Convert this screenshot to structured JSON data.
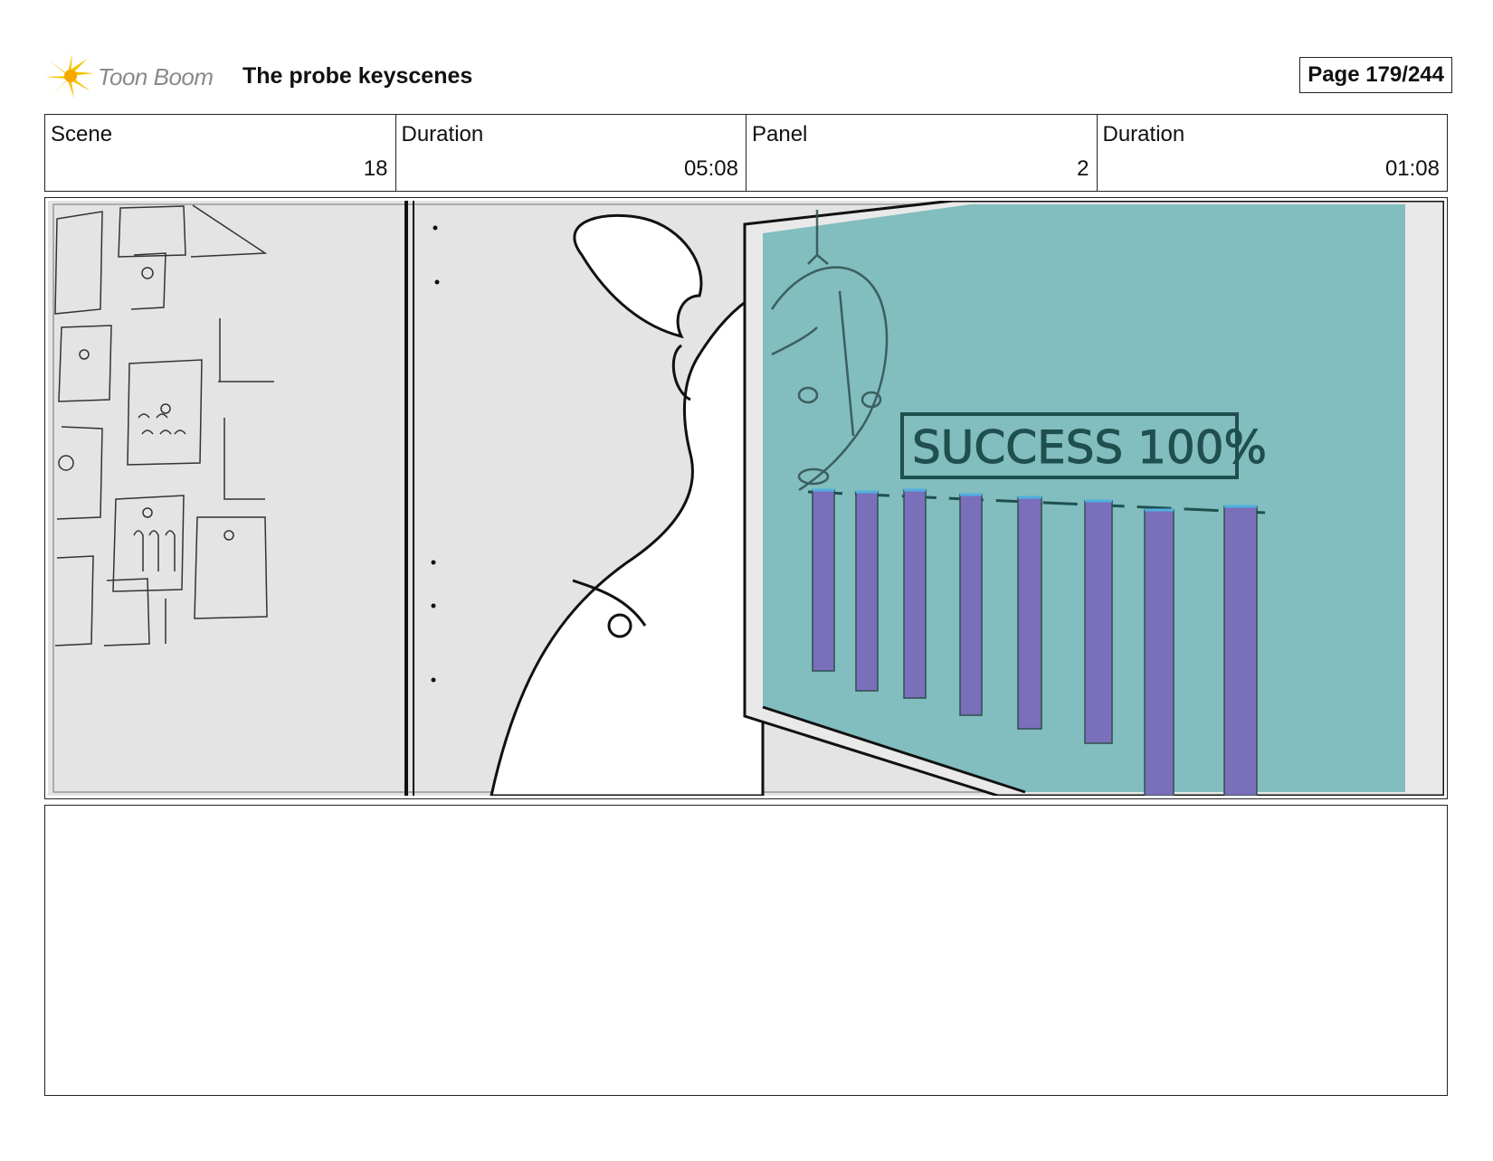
{
  "header": {
    "logo_text": "Toon Boom",
    "doc_title": "The probe keyscenes",
    "page_label": "Page 179/244"
  },
  "info": [
    {
      "label": "Scene",
      "value": "18"
    },
    {
      "label": "Duration",
      "value": "05:08"
    },
    {
      "label": "Panel",
      "value": "2"
    },
    {
      "label": "Duration",
      "value": "01:08"
    }
  ],
  "panel": {
    "screen_text": "SUCCESS 100%",
    "colors": {
      "screen": "#82bdbf",
      "bars": "#7a6fba",
      "wall": "#e4e4e4",
      "ink": "#111111"
    },
    "bar_count": 8
  },
  "notes": ""
}
